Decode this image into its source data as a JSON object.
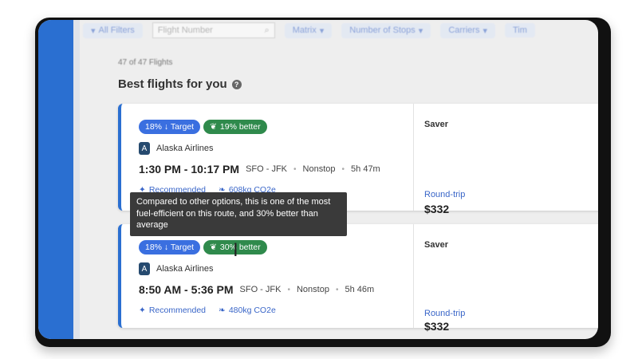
{
  "filters": {
    "all_filters": "All Filters",
    "flight_number_placeholder": "Flight Number",
    "matrix": "Matrix",
    "stops": "Number of Stops",
    "carriers": "Carriers",
    "more": "Tim"
  },
  "results": {
    "count": "47 of 47 Flights",
    "title": "Best flights for you"
  },
  "flights": [
    {
      "target_badge": "18% ↓ Target",
      "eco_badge": "19% better",
      "airline": "Alaska Airlines",
      "times": "1:30 PM - 10:17 PM",
      "route": "SFO - JFK",
      "stops": "Nonstop",
      "duration": "5h 47m",
      "recommended": "Recommended",
      "co2": "608kg CO2e",
      "fare_class": "Saver",
      "trip_type": "Round-trip",
      "price": "$332"
    },
    {
      "target_badge": "18% ↓ Target",
      "eco_badge": "30% better",
      "airline": "Alaska Airlines",
      "times": "8:50 AM - 5:36 PM",
      "route": "SFO - JFK",
      "stops": "Nonstop",
      "duration": "5h 46m",
      "recommended": "Recommended",
      "co2": "480kg CO2e",
      "fare_class": "Saver",
      "trip_type": "Round-trip",
      "price": "$332"
    }
  ],
  "tooltip": {
    "text": "Compared to other options, this is one of the most fuel-efficient on this route, and 30% better than average"
  },
  "colors": {
    "accent": "#2a6fd1",
    "eco_green": "#2f8a4c",
    "target_blue": "#3a6fe0"
  }
}
